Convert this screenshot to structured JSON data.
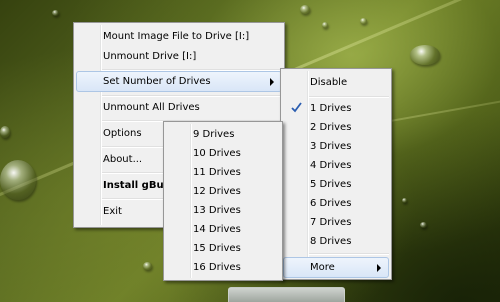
{
  "main_menu": {
    "mount_image": "Mount Image File to Drive [I:]",
    "unmount_drive": "Unmount Drive [I:]",
    "set_number_of_drives": "Set Number of Drives",
    "unmount_all": "Unmount All Drives",
    "options": "Options",
    "about": "About...",
    "install": "Install gBurner",
    "exit": "Exit"
  },
  "drives_menu": {
    "disable": "Disable",
    "items": [
      "1 Drives",
      "2 Drives",
      "3 Drives",
      "4 Drives",
      "5 Drives",
      "6 Drives",
      "7 Drives",
      "8 Drives"
    ],
    "checked": "1 Drives",
    "more": "More"
  },
  "more_menu": {
    "items": [
      "9 Drives",
      "10 Drives",
      "11 Drives",
      "12 Drives",
      "13 Drives",
      "14 Drives",
      "15 Drives",
      "16 Drives"
    ]
  },
  "colors": {
    "menu_background": "#f0f0f0",
    "menu_border": "#979797",
    "highlight_top": "#eef4fc",
    "highlight_bottom": "#d9e6f7",
    "highlight_border": "#adc6e5",
    "check_mark": "#2a5db0",
    "wallpaper_green": "#55661f"
  },
  "icons": {
    "checkmark": "checkmark-icon",
    "submenu_arrow": "chevron-right-icon"
  }
}
